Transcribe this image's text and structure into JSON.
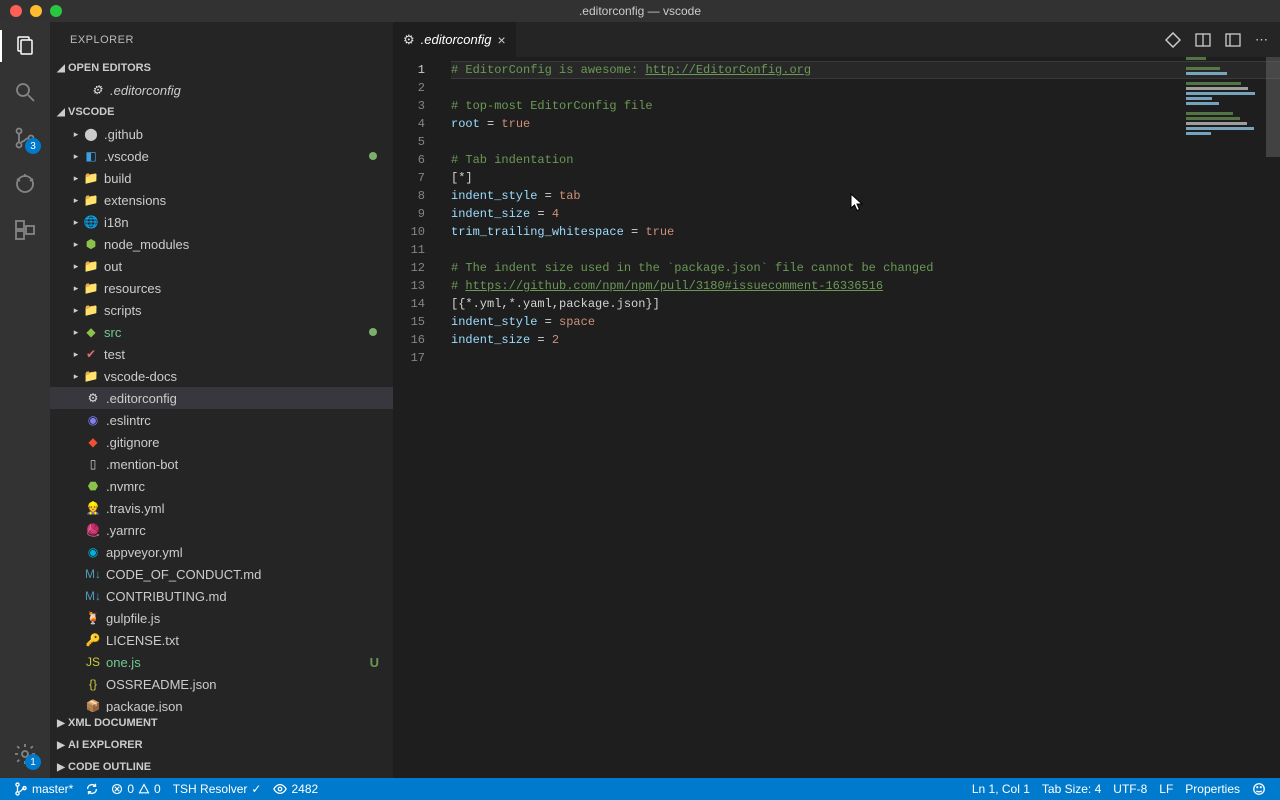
{
  "window": {
    "title": ".editorconfig — vscode"
  },
  "sidebar": {
    "title": "EXPLORER",
    "sections": {
      "openEditors": {
        "label": "OPEN EDITORS",
        "items": [
          {
            "label": ".editorconfig"
          }
        ]
      },
      "workspace": {
        "label": "VSCODE",
        "items": [
          {
            "label": ".github",
            "type": "folder",
            "icon": "github"
          },
          {
            "label": ".vscode",
            "type": "folder",
            "icon": "vscode",
            "modified": true
          },
          {
            "label": "build",
            "type": "folder",
            "icon": "folder"
          },
          {
            "label": "extensions",
            "type": "folder",
            "icon": "folder"
          },
          {
            "label": "i18n",
            "type": "folder",
            "icon": "i18n"
          },
          {
            "label": "node_modules",
            "type": "folder",
            "icon": "nodemodules"
          },
          {
            "label": "out",
            "type": "folder",
            "icon": "folder"
          },
          {
            "label": "resources",
            "type": "folder",
            "icon": "folder"
          },
          {
            "label": "scripts",
            "type": "folder",
            "icon": "folder"
          },
          {
            "label": "src",
            "type": "folder",
            "icon": "src",
            "modified": true,
            "green": true
          },
          {
            "label": "test",
            "type": "folder",
            "icon": "test"
          },
          {
            "label": "vscode-docs",
            "type": "folder",
            "icon": "folder"
          },
          {
            "label": ".editorconfig",
            "type": "file",
            "icon": "editorconfig",
            "selected": true
          },
          {
            "label": ".eslintrc",
            "type": "file",
            "icon": "eslint"
          },
          {
            "label": ".gitignore",
            "type": "file",
            "icon": "git"
          },
          {
            "label": ".mention-bot",
            "type": "file",
            "icon": "file"
          },
          {
            "label": ".nvmrc",
            "type": "file",
            "icon": "nvm"
          },
          {
            "label": ".travis.yml",
            "type": "file",
            "icon": "travis"
          },
          {
            "label": ".yarnrc",
            "type": "file",
            "icon": "yarn"
          },
          {
            "label": "appveyor.yml",
            "type": "file",
            "icon": "appveyor"
          },
          {
            "label": "CODE_OF_CONDUCT.md",
            "type": "file",
            "icon": "md"
          },
          {
            "label": "CONTRIBUTING.md",
            "type": "file",
            "icon": "md"
          },
          {
            "label": "gulpfile.js",
            "type": "file",
            "icon": "gulp"
          },
          {
            "label": "LICENSE.txt",
            "type": "file",
            "icon": "license"
          },
          {
            "label": "one.js",
            "type": "file",
            "icon": "js",
            "git": "U",
            "green": true
          },
          {
            "label": "OSSREADME.json",
            "type": "file",
            "icon": "json"
          },
          {
            "label": "package.json",
            "type": "file",
            "icon": "npm"
          }
        ]
      },
      "xmlDocument": {
        "label": "XML DOCUMENT"
      },
      "aiExplorer": {
        "label": "AI EXPLORER"
      },
      "codeOutline": {
        "label": "CODE OUTLINE"
      }
    }
  },
  "activitybar": {
    "scmBadge": "3",
    "settingsBadge": "1"
  },
  "tabs": {
    "active": {
      "label": ".editorconfig"
    }
  },
  "editor": {
    "lineCount": 17,
    "code": {
      "1": {
        "comment": "# EditorConfig is awesome: ",
        "link": "http://EditorConfig.org"
      },
      "3": {
        "comment": "# top-most EditorConfig file"
      },
      "4": {
        "key": "root",
        "op": " = ",
        "val": "true"
      },
      "6": {
        "comment": "# Tab indentation"
      },
      "7": {
        "section": "[*]"
      },
      "8": {
        "key": "indent_style",
        "op": " = ",
        "val": "tab"
      },
      "9": {
        "key": "indent_size",
        "op": " = ",
        "val": "4"
      },
      "10": {
        "key": "trim_trailing_whitespace",
        "op": " = ",
        "val": "true"
      },
      "12": {
        "comment": "# The indent size used in the `package.json` file cannot be changed"
      },
      "13": {
        "comment": "# ",
        "link": "https://github.com/npm/npm/pull/3180#issuecomment-16336516"
      },
      "14": {
        "section": "[{*.yml,*.yaml,package.json}]"
      },
      "15": {
        "key": "indent_style",
        "op": " = ",
        "val": "space"
      },
      "16": {
        "key": "indent_size",
        "op": " = ",
        "val": "2"
      }
    }
  },
  "statusbar": {
    "branch": "master*",
    "errors": "0",
    "warnings": "0",
    "resolver": "TSH Resolver",
    "eye": "2482",
    "lncol": "Ln 1, Col 1",
    "tabsize": "Tab Size: 4",
    "encoding": "UTF-8",
    "eol": "LF",
    "language": "Properties"
  },
  "icons": {
    "github": "⬤",
    "vscode": "◧",
    "folder": "📁",
    "i18n": "🌐",
    "nodemodules": "⬢",
    "src": "◆",
    "test": "✔",
    "editorconfig": "⚙",
    "eslint": "◉",
    "git": "◆",
    "file": "▯",
    "nvm": "⬣",
    "travis": "👷",
    "yarn": "🧶",
    "appveyor": "◉",
    "md": "M↓",
    "gulp": "🍹",
    "license": "🔑",
    "js": "JS",
    "json": "{}",
    "npm": "📦"
  },
  "iconColors": {
    "github": "#cccccc",
    "vscode": "#3ba0e6",
    "folder": "#dcb67a",
    "i18n": "#3ba0e6",
    "nodemodules": "#8bc34a",
    "src": "#8bc34a",
    "test": "#e06c75",
    "editorconfig": "#e0e0e0",
    "eslint": "#8080f2",
    "git": "#f05133",
    "file": "#cccccc",
    "nvm": "#8bc34a",
    "travis": "#cb3349",
    "yarn": "#2c8ebb",
    "appveyor": "#00b3e0",
    "md": "#519aba",
    "gulp": "#cf4647",
    "license": "#dcb67a",
    "js": "#cbcb41",
    "json": "#cbcb41",
    "npm": "#cb3837"
  }
}
